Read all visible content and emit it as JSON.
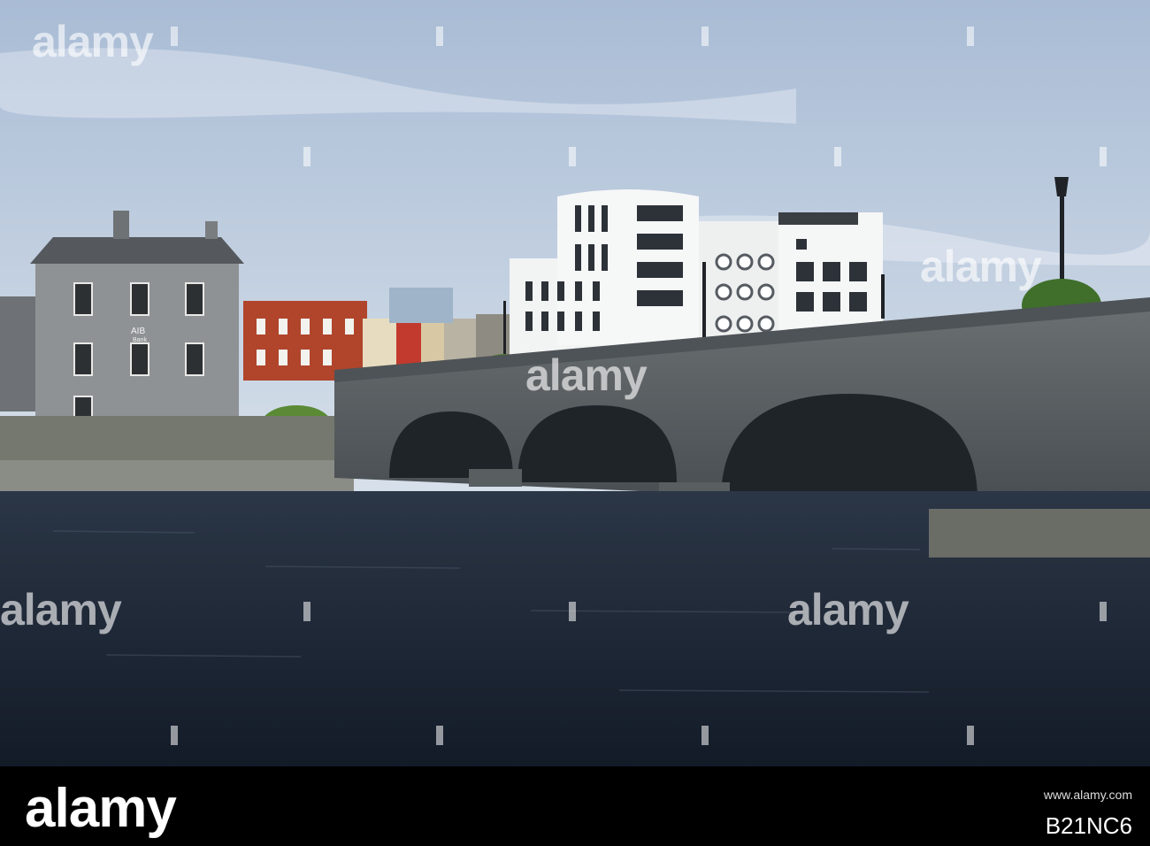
{
  "photo": {
    "bank_sign": "AIB",
    "bank_sign_sub": "Bank",
    "colors": {
      "sky": "#b9c9de",
      "water": "#1b2634",
      "stone": "#5d6266",
      "white_building": "#f3f4f4",
      "red_building": "#b0452c",
      "foliage": "#5b8a35"
    }
  },
  "watermarks": [
    "alamy",
    "alamy",
    "alamy",
    "alamy",
    "alamy",
    "alamy",
    "alamy"
  ],
  "footer": {
    "logo": "alamy",
    "url": "www.alamy.com",
    "image_id": "B21NC6"
  }
}
